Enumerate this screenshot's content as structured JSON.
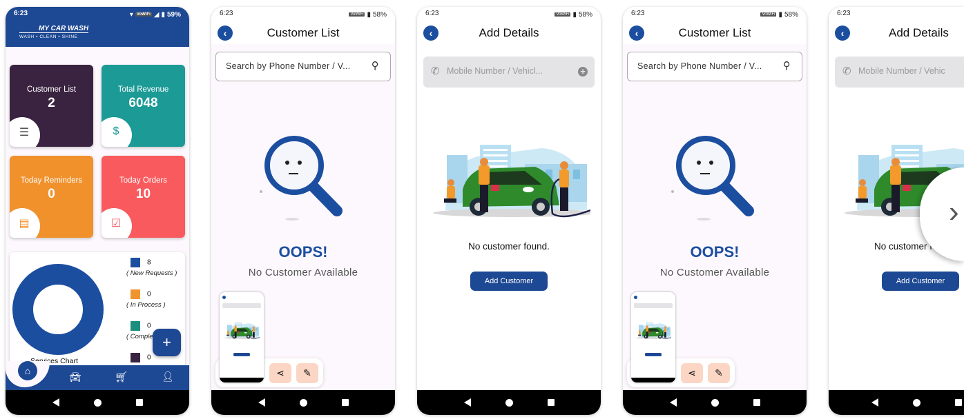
{
  "status": {
    "time": "6:23",
    "battery_home": "59%",
    "battery_other": "58%",
    "wifi_label": "VoWiFi"
  },
  "home": {
    "brand": "MY CAR WASH",
    "tagline": "WASH • CLEAN • SHINE",
    "cards": [
      {
        "label": "Customer List",
        "value": "2",
        "color": "#3a2340",
        "icon": "customer-list-icon"
      },
      {
        "label": "Total Revenue",
        "value": "6048",
        "color": "#1b9a96",
        "icon": "revenue-icon"
      },
      {
        "label": "Today Reminders",
        "value": "0",
        "color": "#f0912c",
        "icon": "reminder-icon"
      },
      {
        "label": "Today Orders",
        "value": "10",
        "color": "#f95a5d",
        "icon": "orders-icon"
      }
    ],
    "chart_title": "Services Chart",
    "legend": [
      {
        "value": "8",
        "label": "( New Requests )",
        "color": "#1c4ea0"
      },
      {
        "value": "0",
        "label": "( In Process )",
        "color": "#f0952e"
      },
      {
        "value": "0",
        "label": "( Completed )",
        "color": "#1a8f7d"
      },
      {
        "value": "0",
        "label": "",
        "color": "#3a2340"
      }
    ],
    "fab": "+",
    "nav": [
      "home-icon",
      "car-icon",
      "cart-icon",
      "profile-icon"
    ]
  },
  "customer_list": {
    "title": "Customer List",
    "search_placeholder": "Search by Phone Number / V...",
    "oops": "OOPS!",
    "empty": "No Customer Available"
  },
  "add_details": {
    "title": "Add Details",
    "field_placeholder": "Mobile Number / Vehicl...",
    "field_placeholder_cut": "Mobile Number / Vehic",
    "empty": "No customer found.",
    "empty_cut": "No customer fo",
    "button": "Add Customer"
  },
  "colors": {
    "primary": "#1c4ea0",
    "action_bg": "#fcd6c4"
  }
}
